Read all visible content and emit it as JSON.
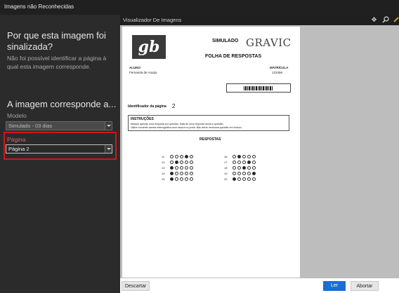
{
  "window": {
    "title": "Imagens não Reconhecidas"
  },
  "left_panel": {
    "question_title": "Por que esta imagem foi sinalizada?",
    "question_text": "Não foi possível identificar a página à qual esta imagem corresponde.",
    "answer_title": "A imagem corresponde a...",
    "model_label": "Modelo",
    "model_value": "Simulado - 03 dias",
    "page_label": "Página",
    "page_value": "Página 2"
  },
  "viewer": {
    "title": "Visualizador De Imagens",
    "icons": [
      "move-icon",
      "zoom-icon",
      "pen-icon"
    ]
  },
  "document": {
    "logo_text": "gb",
    "header_title": "SIMULADO",
    "brand": "GRAVIC",
    "form_title": "FOLHA DE RESPOSTAS",
    "student_label": "ALUNO",
    "student_name": "Fernanda de Araújo",
    "registration_label": "MATRÍCULA",
    "registration_value": "123456",
    "page_id_label": "Identificador da página",
    "page_id_value": "2",
    "instructions_title": "INSTRUÇÕES",
    "instructions_line1": "Marque apenas uma resposta por questão. Mais de uma resposta anula a questão.",
    "instructions_line2": "Utilize somente caneta esferográfica azul escura ou preta. Não deixe nenhuma questão em branco.",
    "answers_title": "RESPOSTAS",
    "answers_left": [
      {
        "num": "11",
        "filled": 3
      },
      {
        "num": "12",
        "filled": 1
      },
      {
        "num": "13",
        "filled": 0
      },
      {
        "num": "14",
        "filled": 0
      },
      {
        "num": "15",
        "filled": 0
      }
    ],
    "answers_right": [
      {
        "num": "16",
        "filled": 1
      },
      {
        "num": "17",
        "filled": 3
      },
      {
        "num": "18",
        "filled": 2
      },
      {
        "num": "19",
        "filled": 4
      },
      {
        "num": "20",
        "filled": 0
      }
    ]
  },
  "actions": {
    "discard": "Descartar",
    "read": "Ler",
    "abort": "Abortar"
  }
}
